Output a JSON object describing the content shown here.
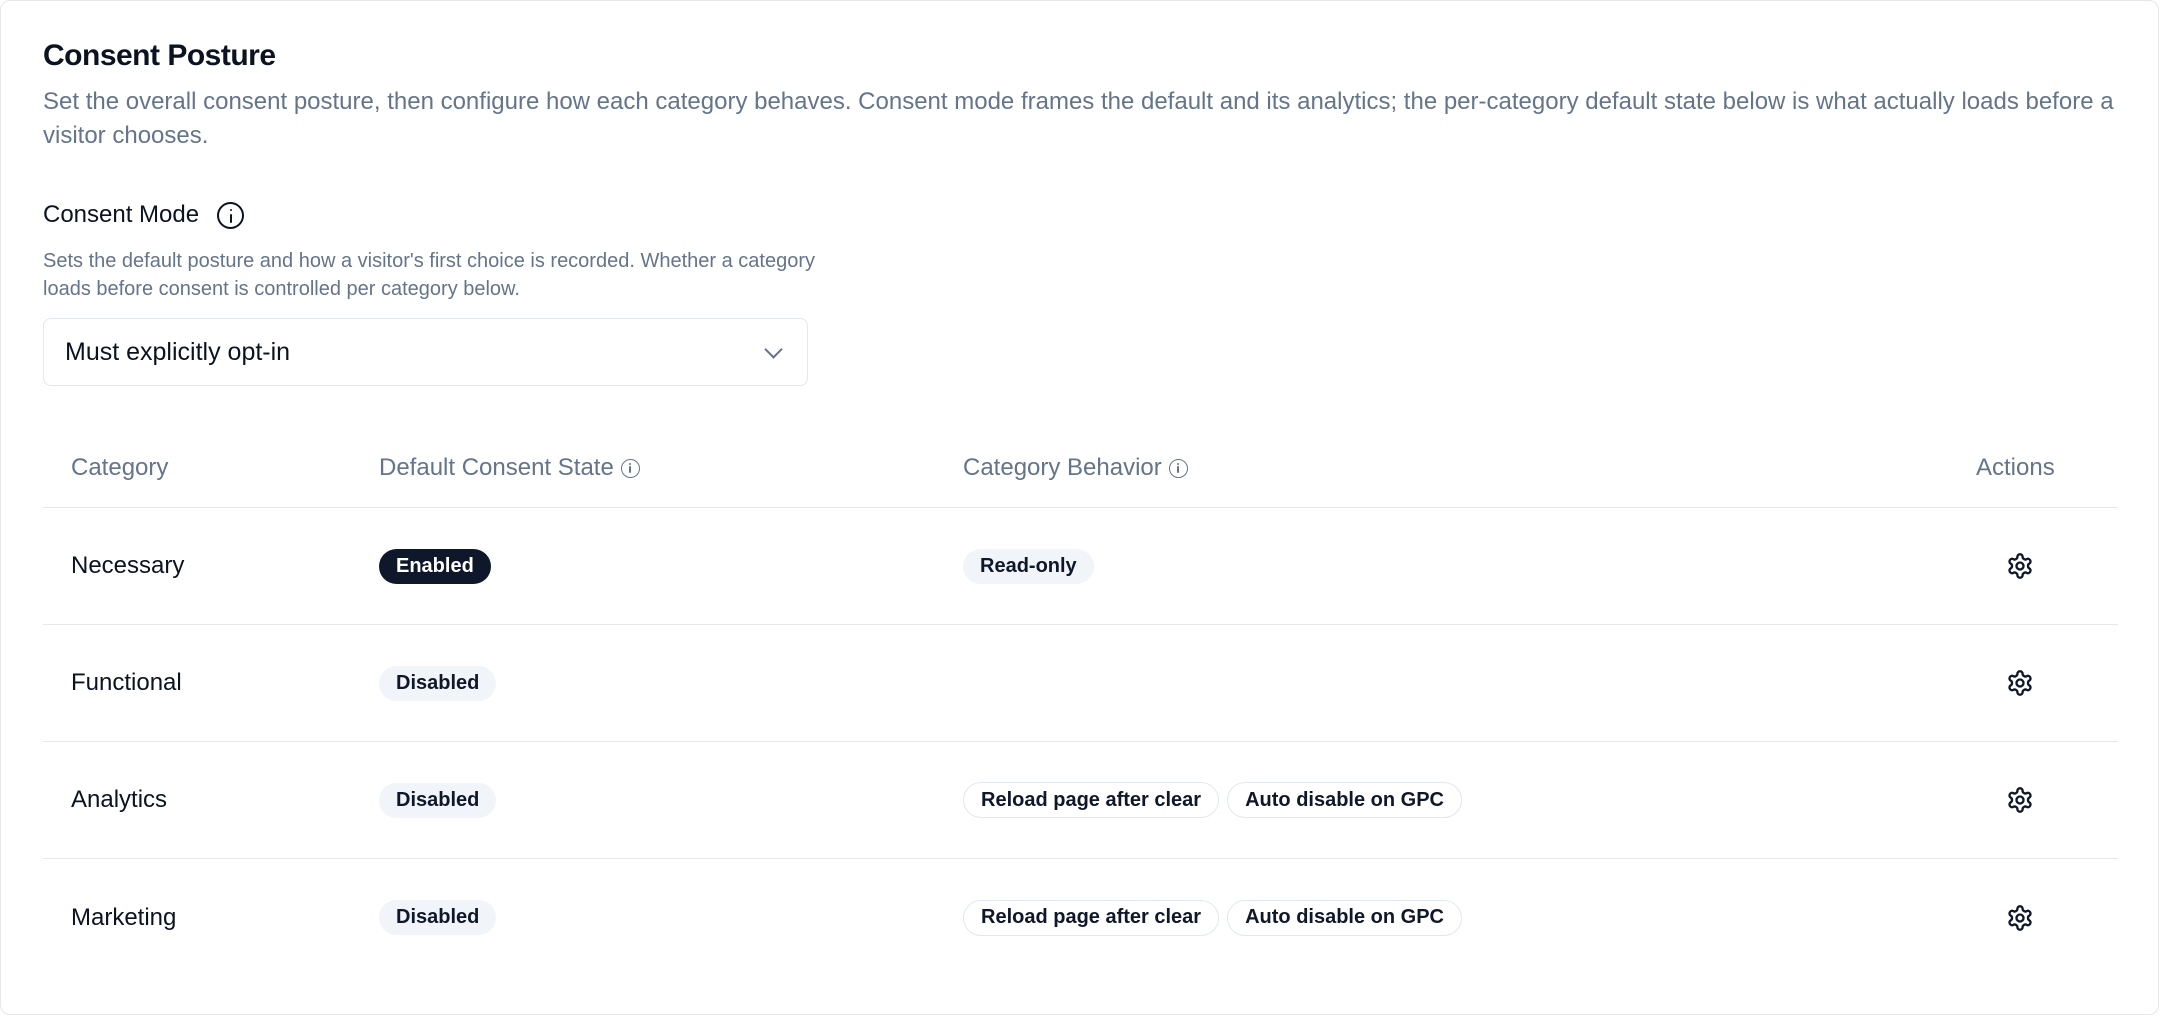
{
  "header": {
    "title": "Consent Posture",
    "description": "Set the overall consent posture, then configure how each category behaves. Consent mode frames the default and its analytics; the per-category default state below is what actually loads before a visitor chooses."
  },
  "consent_mode": {
    "label": "Consent Mode",
    "help": "Sets the default posture and how a visitor's first choice is recorded. Whether a category loads before consent is controlled per category below.",
    "selected": "Must explicitly opt-in"
  },
  "table": {
    "columns": {
      "category": "Category",
      "default_state": "Default Consent State",
      "behavior": "Category Behavior",
      "actions": "Actions"
    },
    "rows": [
      {
        "category": "Necessary",
        "state": "Enabled",
        "behaviors": [
          "Read-only"
        ]
      },
      {
        "category": "Functional",
        "state": "Disabled",
        "behaviors": []
      },
      {
        "category": "Analytics",
        "state": "Disabled",
        "behaviors": [
          "Reload page after clear",
          "Auto disable on GPC"
        ]
      },
      {
        "category": "Marketing",
        "state": "Disabled",
        "behaviors": [
          "Reload page after clear",
          "Auto disable on GPC"
        ]
      }
    ]
  },
  "icons": {
    "info": "info-circle-icon",
    "chevron": "chevron-down-icon",
    "gear": "gear-icon"
  },
  "colors": {
    "enabled_badge": "#0f172a",
    "muted_text": "#64748b",
    "soft_badge": "#f1f5f9"
  }
}
